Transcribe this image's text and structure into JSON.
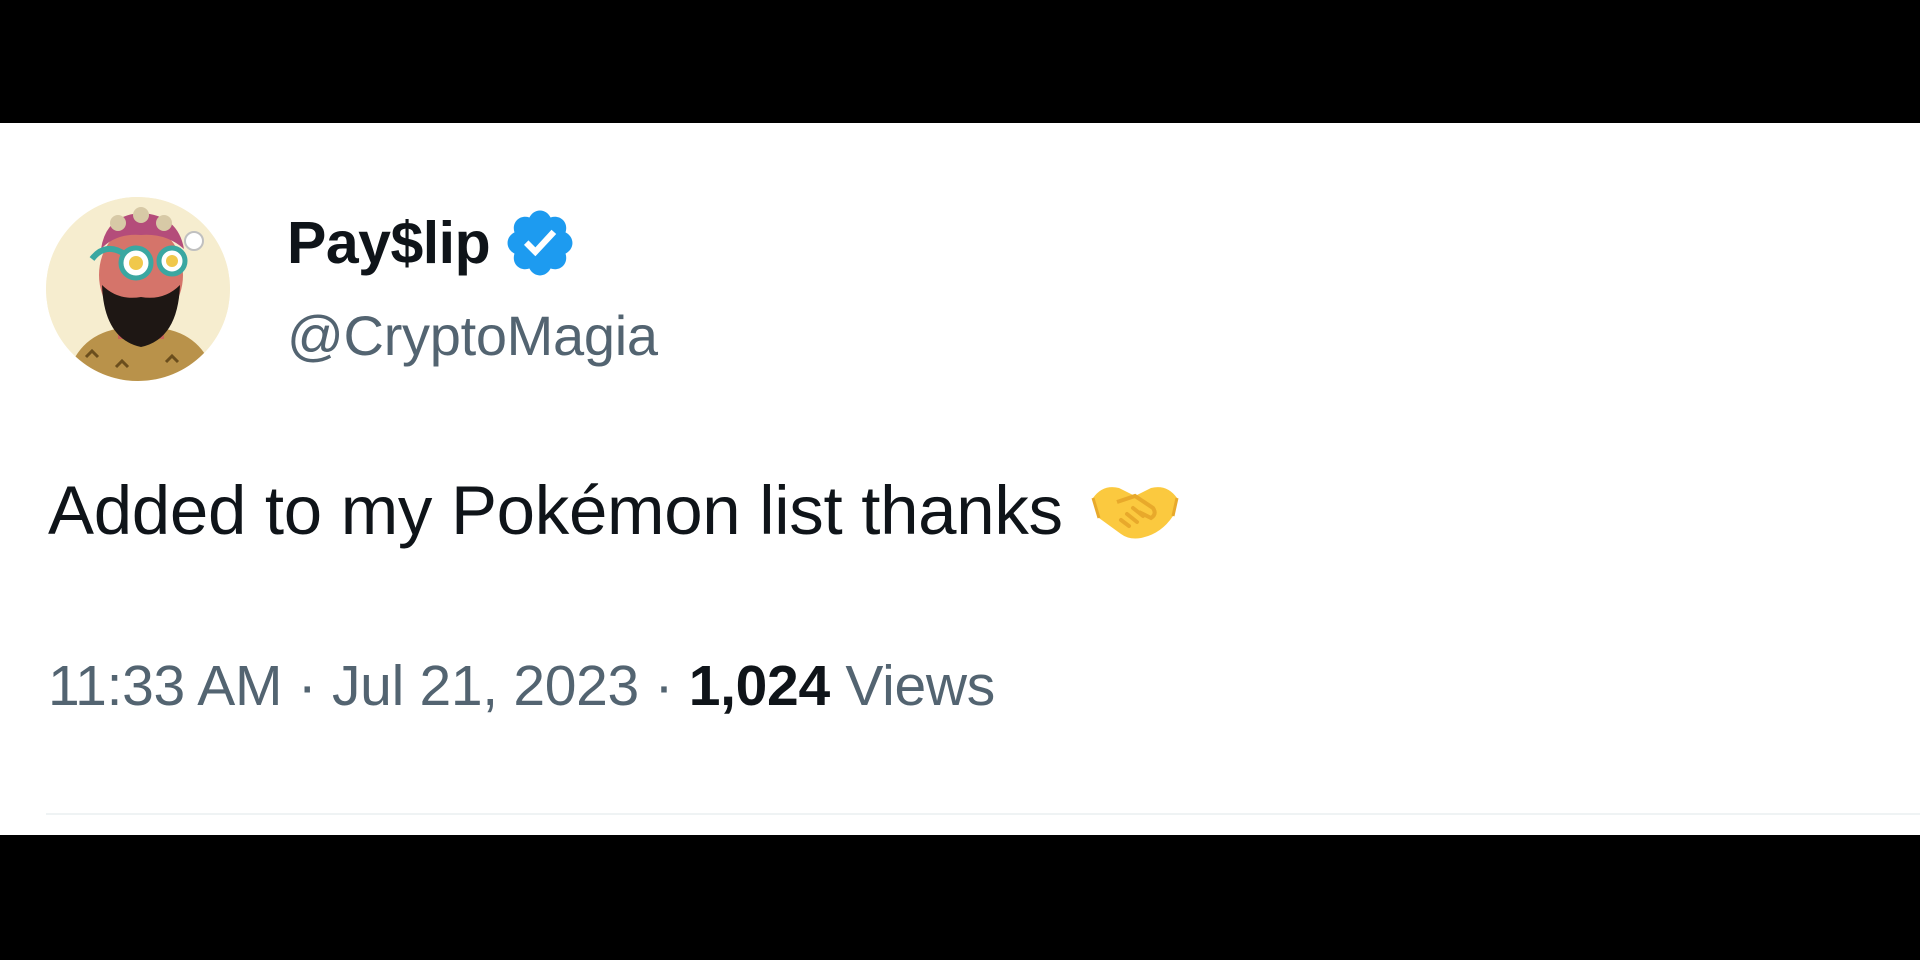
{
  "tweet": {
    "author": {
      "display_name": "Pay$lip",
      "handle": "@CryptoMagia",
      "verified": true,
      "verified_color": "#1d9bf0",
      "avatar_icon": "bearded-nft-avatar"
    },
    "text": "Added to my Pokémon list thanks",
    "emoji": "handshake-emoji",
    "time": "11:33 AM",
    "separator": " · ",
    "date": "Jul 21, 2023",
    "views_count": "1,024",
    "views_label": " Views"
  },
  "colors": {
    "background": "#ffffff",
    "primary_text": "#0f1419",
    "secondary_text": "#536471",
    "accent": "#1d9bf0",
    "letterbox": "#000000"
  }
}
